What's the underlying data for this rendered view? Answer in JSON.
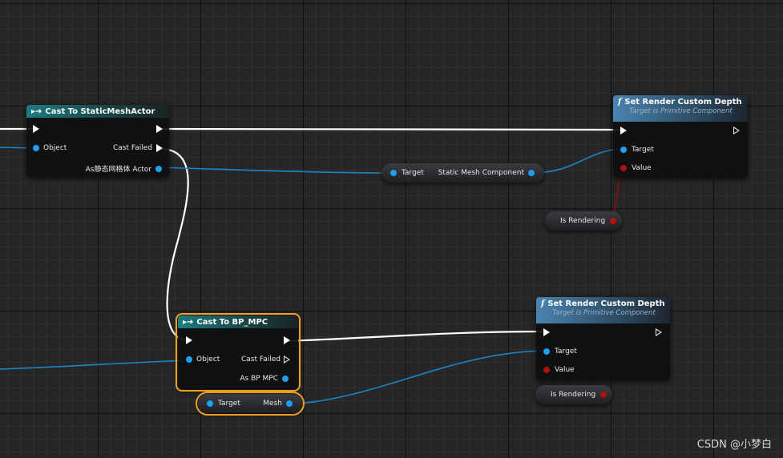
{
  "nodes": {
    "cast_static": {
      "title": "Cast To StaticMeshActor",
      "object": "Object",
      "cast_failed": "Cast Failed",
      "as_output": "As静态网格体 Actor"
    },
    "set_render_1": {
      "title": "Set Render Custom Depth",
      "subtitle": "Target is Primitive Component",
      "target": "Target",
      "value": "Value"
    },
    "static_mesh_getter": {
      "target": "Target",
      "output": "Static Mesh Component"
    },
    "is_rendering_1": {
      "label": "Is Rendering"
    },
    "cast_bp": {
      "title": "Cast To BP_MPC",
      "object": "Object",
      "cast_failed": "Cast Failed",
      "as_output": "As BP MPC"
    },
    "set_render_2": {
      "title": "Set Render Custom Depth",
      "subtitle": "Target is Primitive Component",
      "target": "Target",
      "value": "Value"
    },
    "is_rendering_2": {
      "label": "Is Rendering"
    },
    "mesh_getter": {
      "target": "Target",
      "output": "Mesh"
    }
  },
  "icons": {
    "cast": "cast-arrow-icon",
    "function": "function-f-icon",
    "exec": "exec-pin-icon",
    "data": "data-pin-icon"
  },
  "colors": {
    "object_pin": "#1ea0ef",
    "bool_pin": "#b01010",
    "exec_wire": "#ffffff",
    "selection": "#f0a020"
  },
  "watermark": "CSDN @小梦白"
}
